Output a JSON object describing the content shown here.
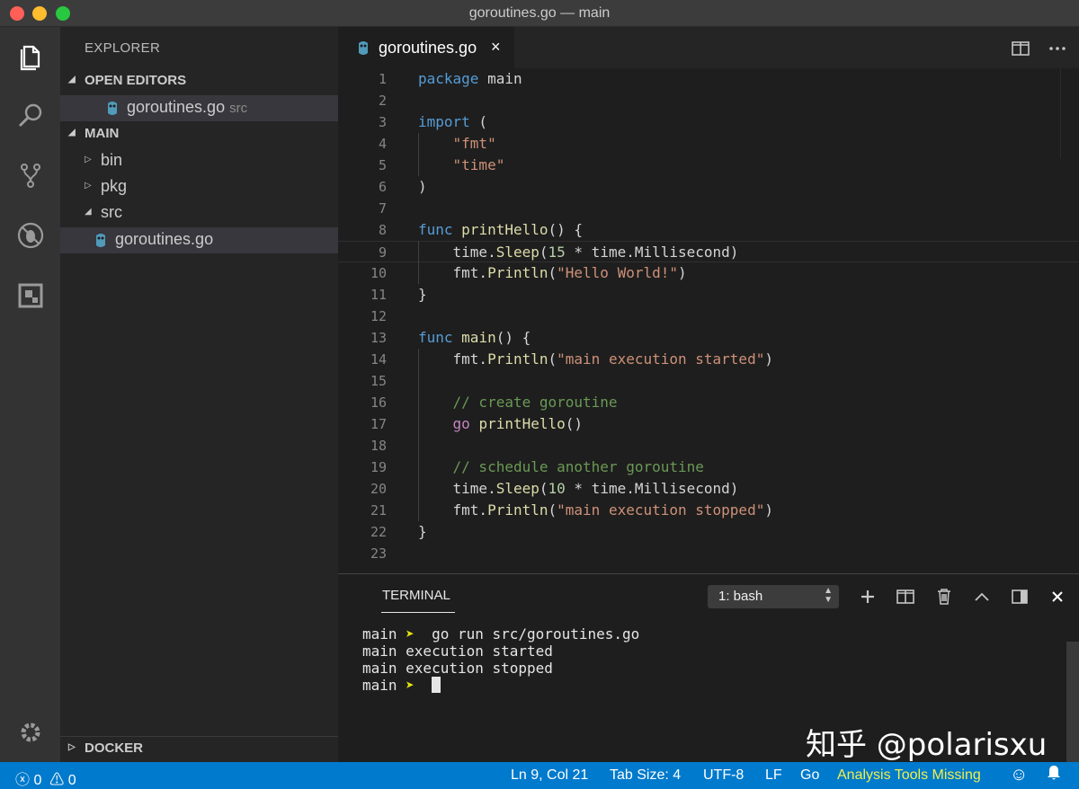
{
  "window": {
    "title": "goroutines.go — main"
  },
  "activity_bar": {
    "icons": [
      "files-icon",
      "search-icon",
      "source-control-icon",
      "debug-icon",
      "extensions-icon",
      "gear-icon"
    ]
  },
  "sidebar": {
    "title": "EXPLORER",
    "open_editors": {
      "label": "OPEN EDITORS",
      "items": [
        {
          "name": "goroutines.go",
          "desc": "src"
        }
      ]
    },
    "main": {
      "label": "MAIN",
      "tree": [
        {
          "name": "bin",
          "expanded": false
        },
        {
          "name": "pkg",
          "expanded": false
        },
        {
          "name": "src",
          "expanded": true
        },
        {
          "name": "goroutines.go",
          "selected": true
        }
      ]
    },
    "docker": {
      "label": "DOCKER"
    }
  },
  "editor": {
    "tab": {
      "label": "goroutines.go",
      "close": "×"
    },
    "current_line": 9,
    "lines": [
      "package main",
      "",
      "import (",
      "    \"fmt\"",
      "    \"time\"",
      ")",
      "",
      "func printHello() {",
      "    time.Sleep(15 * time.Millisecond)",
      "    fmt.Println(\"Hello World!\")",
      "}",
      "",
      "func main() {",
      "    fmt.Println(\"main execution started\")",
      "",
      "    // create goroutine",
      "    go printHello()",
      "",
      "    // schedule another goroutine",
      "    time.Sleep(10 * time.Millisecond)",
      "    fmt.Println(\"main execution stopped\")",
      "}",
      ""
    ]
  },
  "panel": {
    "title": "TERMINAL",
    "terminal_select": "1: bash",
    "output": [
      {
        "prompt": "main",
        "arrow": "➤",
        "cmd": "go run src/goroutines.go"
      },
      {
        "text": "main execution started"
      },
      {
        "text": "main execution stopped"
      },
      {
        "prompt": "main",
        "arrow": "➤",
        "cmd": ""
      }
    ]
  },
  "watermark": "知乎 @polarisxu",
  "statusbar": {
    "errors": "0",
    "warnings": "0",
    "position": "Ln 9, Col 21",
    "tab_size": "Tab Size: 4",
    "encoding": "UTF-8",
    "eol": "LF",
    "language": "Go",
    "analysis": "Analysis Tools Missing"
  },
  "colors": {
    "statusbar": "#007acc",
    "keyword": "#569cd6",
    "function": "#dcdcaa",
    "string": "#ce9178",
    "comment": "#6a9955",
    "number": "#b5cea8",
    "warning": "#f0f04a"
  }
}
